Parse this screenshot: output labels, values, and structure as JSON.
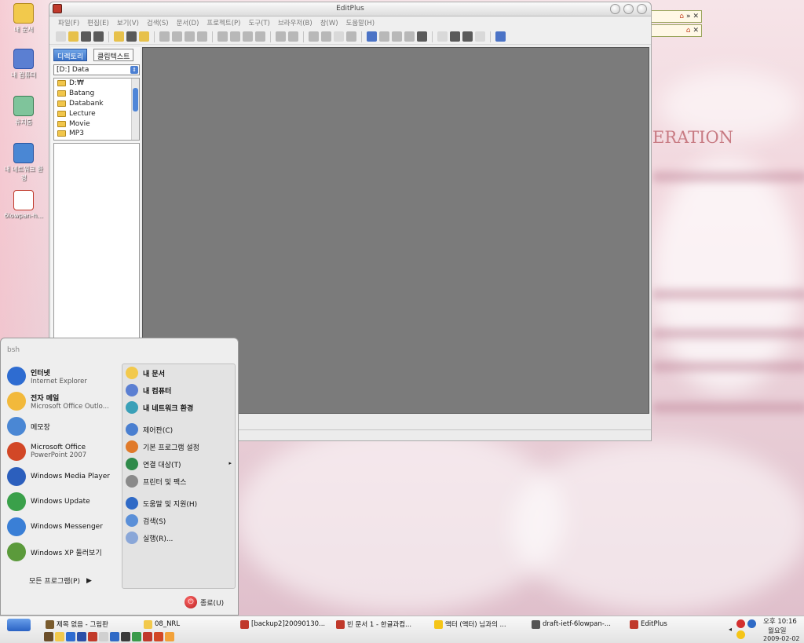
{
  "desktop": {
    "wallpaper_text": "ERATION",
    "icons": [
      {
        "label": "내 문서",
        "icon": "my-documents-folder-icon"
      },
      {
        "label": "내 컴퓨터",
        "icon": "my-computer-icon"
      },
      {
        "label": "휴지통",
        "icon": "recycle-bin-icon"
      },
      {
        "label": "내 네트워크 환경",
        "icon": "network-places-icon"
      },
      {
        "label": "6lowpan-h...",
        "icon": "document-file-icon"
      }
    ]
  },
  "editplus": {
    "title": "EditPlus",
    "menu": [
      "파일(F)",
      "편집(E)",
      "보기(V)",
      "검색(S)",
      "문서(D)",
      "프로젝트(P)",
      "도구(T)",
      "브라우저(B)",
      "창(W)",
      "도움말(H)"
    ],
    "side_tabs": [
      "디렉토리",
      "클립텍스트"
    ],
    "drive": "[D:] Data",
    "tree": [
      "D:₩",
      "Batang",
      "Databank",
      "Lecture",
      "Movie",
      "MP3"
    ]
  },
  "minibars": [
    {
      "icons": [
        "smiley-icon",
        "home-icon",
        "more-icon",
        "close-icon"
      ],
      "more": "»",
      "close": "✕"
    },
    {
      "icons": [
        "smiley-icon",
        "home-icon",
        "close-icon"
      ],
      "close": "✕"
    }
  ],
  "startmenu": {
    "user": "bsh",
    "left_items": [
      {
        "title": "인터넷",
        "subtitle": "Internet Explorer",
        "bold": true,
        "color": "#2e6cd1"
      },
      {
        "title": "전자 메일",
        "subtitle": "Microsoft Office Outlo...",
        "bold": true,
        "color": "#f2b93b"
      },
      {
        "title": "메모장",
        "subtitle": "",
        "bold": false,
        "color": "#4a87d4"
      },
      {
        "title": "Microsoft Office",
        "subtitle": "PowerPoint 2007",
        "bold": false,
        "color": "#d24726"
      },
      {
        "title": "Windows Media Player",
        "subtitle": "",
        "bold": false,
        "color": "#2c5fbd"
      },
      {
        "title": "Windows Update",
        "subtitle": "",
        "bold": false,
        "color": "#3aa04a"
      },
      {
        "title": "Windows Messenger",
        "subtitle": "",
        "bold": false,
        "color": "#3a7fd6"
      },
      {
        "title": "Windows XP 둘러보기",
        "subtitle": "",
        "bold": false,
        "color": "#5b9a3b"
      }
    ],
    "all_programs": "모든 프로그램(P)",
    "all_programs_arrow": "▶",
    "right_items": [
      {
        "label": "내 문서",
        "bold": true,
        "color": "#f2c94c"
      },
      {
        "label": "내 컴퓨터",
        "bold": true,
        "color": "#5b7fd2"
      },
      {
        "label": "내 네트워크 환경",
        "bold": true,
        "color": "#3aa0b8"
      },
      {
        "label": "제어판(C)",
        "bold": false,
        "color": "#4a7fd0"
      },
      {
        "label": "기본 프로그램 설정",
        "bold": false,
        "color": "#e07a2a"
      },
      {
        "label": "연결 대상(T)",
        "bold": false,
        "color": "#2f8a4a",
        "arrow": "▸"
      },
      {
        "label": "프린터 및 팩스",
        "bold": false,
        "color": "#8a8a8a"
      },
      {
        "label": "도움말 및 지원(H)",
        "bold": false,
        "color": "#2f6ac6"
      },
      {
        "label": "검색(S)",
        "bold": false,
        "color": "#5a8fd8"
      },
      {
        "label": "실행(R)...",
        "bold": false,
        "color": "#8aa7d8"
      }
    ],
    "shutdown": "종료(U)",
    "shutdown_glyph": "⏻"
  },
  "taskbar": {
    "start_glyph": "",
    "tasks": [
      {
        "label": "제목 없음 - 그림판",
        "color": "#7a5c2e"
      },
      {
        "label": "08_NRL",
        "color": "#f2c94c"
      },
      {
        "label": "[backup2]20090130...",
        "color": "#c0392b"
      },
      {
        "label": "빈 문서 1 - 한글과컴...",
        "color": "#c0392b"
      },
      {
        "label": "액터 (액터) 님과의 ...",
        "color": "#f5c518"
      },
      {
        "label": "draft-ietf-6lowpan-...",
        "color": "#555555"
      },
      {
        "label": "EditPlus",
        "color": "#c0392b"
      }
    ],
    "quick_launch": [
      "#6b4e2a",
      "#f2c94c",
      "#2e6cd1",
      "#2a4fa8",
      "#c23a2a",
      "#d0d0d0",
      "#2f6ac6",
      "#3a3a3a",
      "#3a9a4a",
      "#c0392b",
      "#d24726",
      "#f2a23a"
    ],
    "clock_time": "오후 10:16",
    "clock_day": "월요일",
    "clock_date": "2009-02-02",
    "tray_arrow": "◂"
  }
}
